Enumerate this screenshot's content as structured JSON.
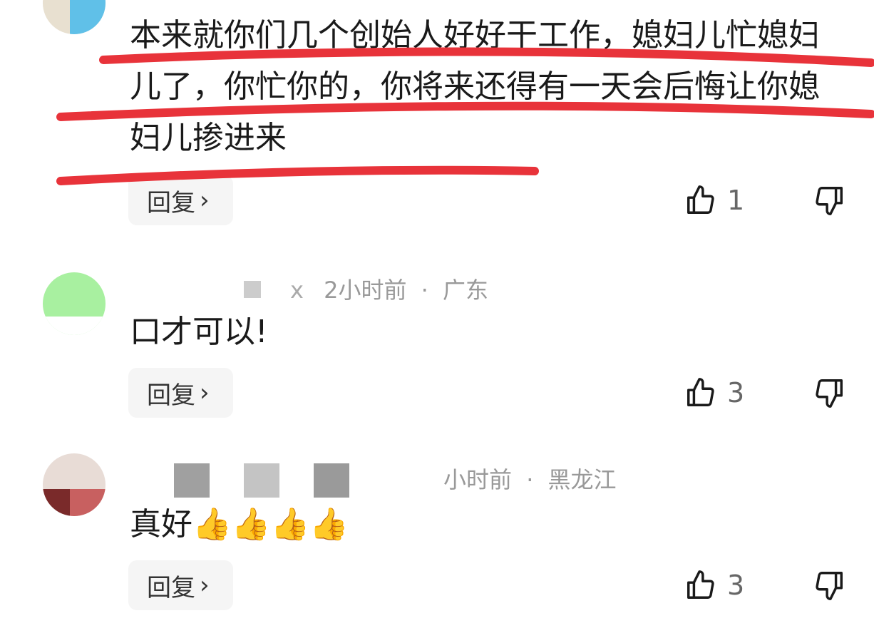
{
  "comments": [
    {
      "text": "本来就你们几个创始人好好干工作，媳妇儿忙媳妇儿了，你忙你的，你将来还得有一天会后悔让你媳妇儿掺进来",
      "reply_label": "回复",
      "likes": "1"
    },
    {
      "user_suffix": "x",
      "time": "2小时前",
      "separator": "·",
      "location": "广东",
      "text": "口才可以!",
      "reply_label": "回复",
      "likes": "3"
    },
    {
      "time": "小时前",
      "separator": "·",
      "location": "黑龙江",
      "text": "真好👍👍👍👍",
      "reply_label": "回复",
      "likes": "3"
    }
  ],
  "colors": {
    "annotation_red": "#e8333a",
    "meta_gray": "#999999",
    "button_bg": "#f5f5f5"
  },
  "icons": {
    "like": "thumbs-up-icon",
    "dislike": "thumbs-down-icon",
    "reply_arrow": "chevron-right-icon"
  }
}
